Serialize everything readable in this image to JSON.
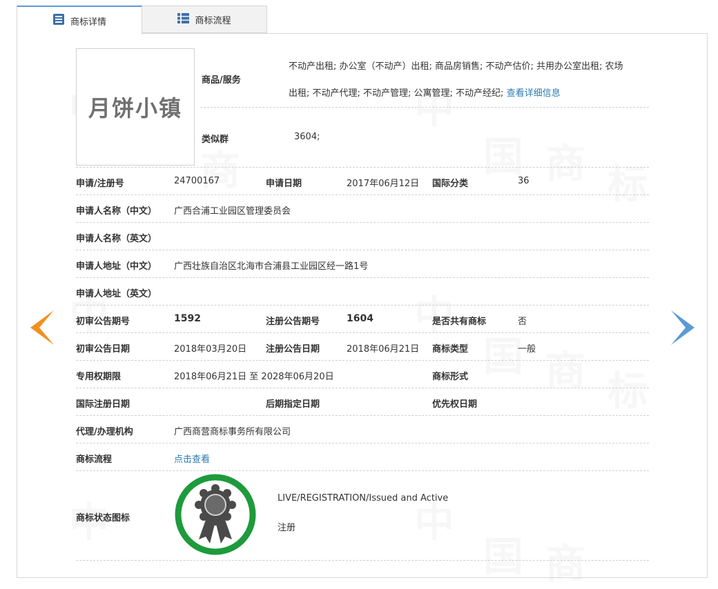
{
  "tabs": [
    {
      "label": "商标详情",
      "icon": "document-list-icon",
      "active": true
    },
    {
      "label": "商标流程",
      "icon": "list-icon",
      "active": false
    }
  ],
  "logo": {
    "text": "月饼小镇"
  },
  "goods": {
    "label": "商品/服务",
    "line1": "不动产出租; 办公室（不动产）出租; 商品房销售; 不动产估价; 共用办公室出租; 农场",
    "line2": "出租; 不动产代理; 不动产管理; 公寓管理; 不动产经纪;",
    "more_link": "查看详细信息"
  },
  "similar_group": {
    "label": "类似群",
    "value": "3604;"
  },
  "rows": {
    "reg_no": {
      "label": "申请/注册号",
      "value": "24700167"
    },
    "apply_date": {
      "label": "申请日期",
      "value": "2017年06月12日"
    },
    "intl_class": {
      "label": "国际分类",
      "value": "36"
    },
    "applicant_cn": {
      "label": "申请人名称（中文）",
      "value": "广西合浦工业园区管理委员会"
    },
    "applicant_en": {
      "label": "申请人名称（英文）",
      "value": ""
    },
    "address_cn": {
      "label": "申请人地址（中文）",
      "value": "广西壮族自治区北海市合浦县工业园区经一路1号"
    },
    "address_en": {
      "label": "申请人地址（英文）",
      "value": ""
    },
    "prelim_pub_no": {
      "label": "初审公告期号",
      "value": "1592"
    },
    "reg_pub_no": {
      "label": "注册公告期号",
      "value": "1604"
    },
    "shared": {
      "label": "是否共有商标",
      "value": "否"
    },
    "prelim_pub_date": {
      "label": "初审公告日期",
      "value": "2018年03月20日"
    },
    "reg_pub_date": {
      "label": "注册公告日期",
      "value": "2018年06月21日"
    },
    "mark_type": {
      "label": "商标类型",
      "value": "一般"
    },
    "exclusive_period": {
      "label": "专用权期限",
      "value": "2018年06月21日 至 2028年06月20日"
    },
    "mark_form": {
      "label": "商标形式",
      "value": ""
    },
    "intl_reg_date": {
      "label": "国际注册日期",
      "value": ""
    },
    "later_designation": {
      "label": "后期指定日期",
      "value": ""
    },
    "priority_date": {
      "label": "优先权日期",
      "value": ""
    },
    "agency": {
      "label": "代理/办理机构",
      "value": "广西商营商标事务所有限公司"
    },
    "process": {
      "label": "商标流程",
      "value": "点击查看"
    },
    "status_icon": {
      "label": "商标状态图标"
    }
  },
  "status": {
    "line1": "LIVE/REGISTRATION/Issued and Active",
    "line2": "注册"
  },
  "colors": {
    "tab_accent": "#5b9bd5",
    "link": "#2a7ab0",
    "prev_arrow": "#f0911e",
    "next_arrow": "#5b9bd5",
    "badge_ring": "#1e9a3c",
    "badge_medal": "#4a4a4a"
  }
}
